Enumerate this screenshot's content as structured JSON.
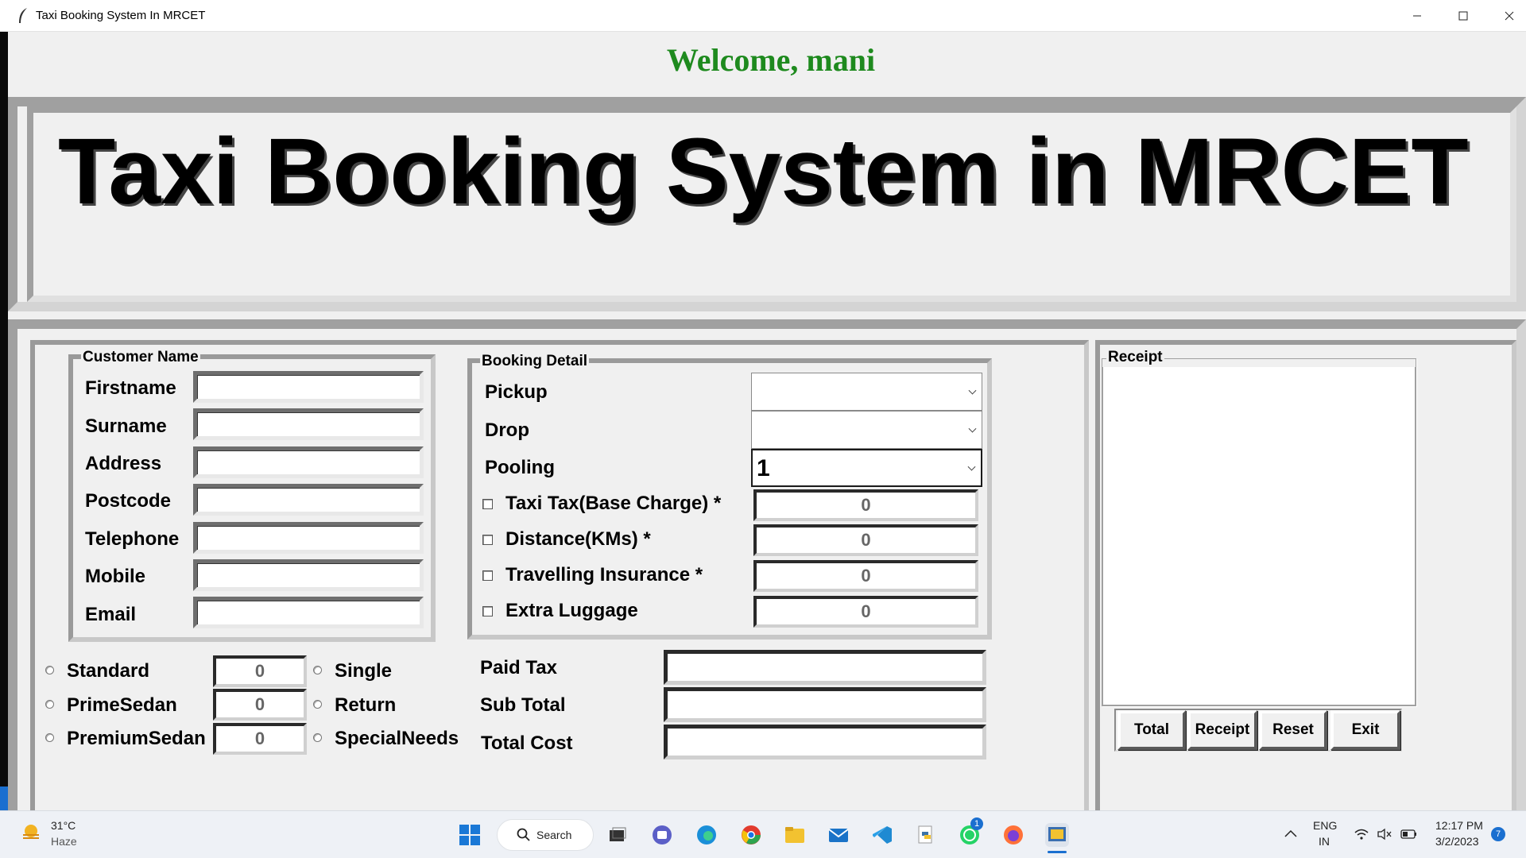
{
  "window": {
    "title": "Taxi Booking System In MRCET"
  },
  "welcome": "Welcome, mani",
  "app_title": "Taxi Booking System in MRCET",
  "customer": {
    "group_title": "Customer Name",
    "fields": [
      {
        "label": "Firstname",
        "value": ""
      },
      {
        "label": "Surname",
        "value": ""
      },
      {
        "label": "Address",
        "value": ""
      },
      {
        "label": "Postcode",
        "value": ""
      },
      {
        "label": "Telephone",
        "value": ""
      },
      {
        "label": "Mobile",
        "value": ""
      },
      {
        "label": "Email",
        "value": ""
      }
    ]
  },
  "booking": {
    "group_title": "Booking Detail",
    "pickup": {
      "label": "Pickup",
      "value": ""
    },
    "drop": {
      "label": "Drop",
      "value": ""
    },
    "pooling": {
      "label": "Pooling",
      "value": "1"
    },
    "charges": [
      {
        "label": "Taxi Tax(Base Charge) *",
        "value": "0"
      },
      {
        "label": "Distance(KMs) *",
        "value": "0"
      },
      {
        "label": "Travelling Insurance *",
        "value": "0"
      },
      {
        "label": "Extra Luggage",
        "value": "0"
      }
    ]
  },
  "car_types": [
    {
      "label": "Standard",
      "value": "0"
    },
    {
      "label": "PrimeSedan",
      "value": "0"
    },
    {
      "label": "PremiumSedan",
      "value": "0"
    }
  ],
  "journey_types": [
    "Single",
    "Return",
    "SpecialNeeds"
  ],
  "totals": [
    {
      "label": "Paid Tax",
      "value": ""
    },
    {
      "label": "Sub Total",
      "value": ""
    },
    {
      "label": "Total Cost",
      "value": ""
    }
  ],
  "receipt": {
    "title": "Receipt",
    "content": ""
  },
  "buttons": {
    "total": "Total",
    "receipt": "Receipt",
    "reset": "Reset",
    "exit": "Exit"
  },
  "taskbar": {
    "weather_temp": "31°C",
    "weather_desc": "Haze",
    "search_label": "Search",
    "lang_top": "ENG",
    "lang_bottom": "IN",
    "time": "12:17 PM",
    "date": "3/2/2023",
    "notification_count": "7",
    "whatsapp_badge": "1"
  },
  "colors": {
    "welcome": "#1e8a1e",
    "taskbar": "#eef1f6",
    "accent": "#1a6fd0"
  }
}
